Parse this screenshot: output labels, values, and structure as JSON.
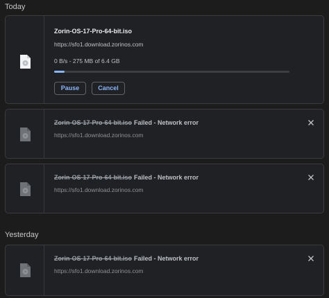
{
  "sections": {
    "today": "Today",
    "yesterday": "Yesterday"
  },
  "active_download": {
    "filename": "Zorin-OS-17-Pro-64-bit.iso",
    "url": "https://sfo1.download.zorinos.com",
    "progress_text": "0 B/s - 275 MB of 6.4 GB",
    "progress_fraction": 0.043,
    "pause_label": "Pause",
    "cancel_label": "Cancel"
  },
  "failed_downloads": [
    {
      "filename": "Zorin-OS-17-Pro-64-bit.iso",
      "status": "Failed - Network error",
      "url": "https://sfo1.download.zorinos.com"
    },
    {
      "filename": "Zorin-OS-17-Pro-64-bit.iso",
      "status": "Failed - Network error",
      "url": "https://sfo1.download.zorinos.com"
    },
    {
      "filename": "Zorin-OS-17-Pro-64-bit.iso",
      "status": "Failed - Network error",
      "url": "https://sfo1.download.zorinos.com"
    }
  ],
  "colors": {
    "accent": "#8ab4f8",
    "background": "#1c1c1d",
    "card": "#202124"
  }
}
